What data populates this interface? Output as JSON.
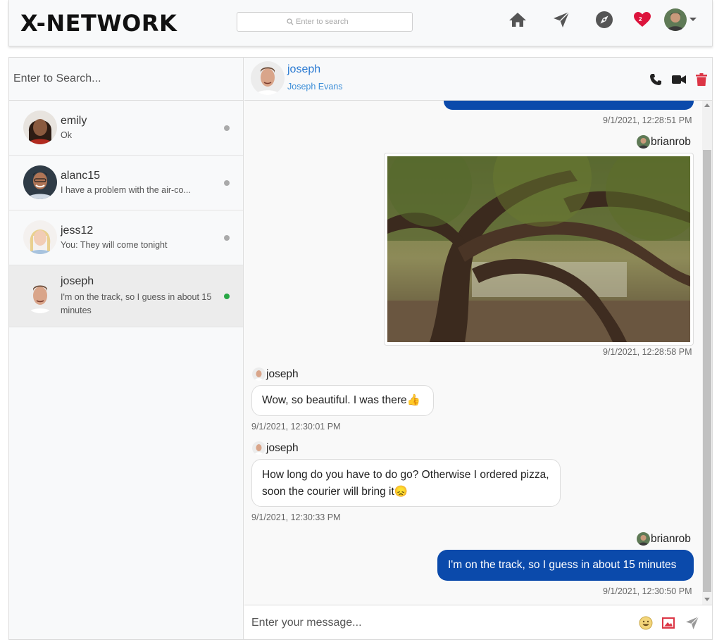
{
  "navbar": {
    "brand": "X-NETWORK",
    "search_placeholder": "Enter to search",
    "notification_count": "2",
    "icons": [
      "home-icon",
      "send-icon",
      "compass-icon",
      "heart-icon",
      "avatar",
      "chevron-down-icon"
    ]
  },
  "sidebar": {
    "search_placeholder": "Enter to Search...",
    "conversations": [
      {
        "name": "emily",
        "last": "Ok",
        "status": "offline"
      },
      {
        "name": "alanc15",
        "last": "I have a problem with the air-co...",
        "status": "offline"
      },
      {
        "name": "jess12",
        "last": "You: They will come tonight",
        "status": "offline"
      },
      {
        "name": "joseph",
        "last": "I'm on the track, so I guess in about 15 minutes",
        "status": "online",
        "active": true
      }
    ]
  },
  "chat": {
    "header": {
      "username": "joseph",
      "fullname": "Joseph Evans"
    },
    "messages": [
      {
        "from": "me",
        "sender": "brianrob",
        "type": "text",
        "text": "",
        "time": "9/1/2021, 12:28:51 PM"
      },
      {
        "from": "me",
        "sender": "brianrob",
        "type": "image",
        "time": "9/1/2021, 12:28:58 PM"
      },
      {
        "from": "them",
        "sender": "joseph",
        "type": "text",
        "text": "Wow, so beautiful. I was there👍",
        "time": "9/1/2021, 12:30:01 PM"
      },
      {
        "from": "them",
        "sender": "joseph",
        "type": "text",
        "text": "How long do you have to do go? Otherwise I ordered pizza, soon the courier will bring it😞",
        "time": "9/1/2021, 12:30:33 PM"
      },
      {
        "from": "me",
        "sender": "brianrob",
        "type": "text",
        "text": "I'm on the track, so I guess in about 15 minutes",
        "time": "9/1/2021, 12:30:50 PM"
      }
    ],
    "composer_placeholder": "Enter your message..."
  },
  "colors": {
    "accent": "#0b4aab",
    "link": "#2a7ad2",
    "danger": "#dc3545",
    "online": "#28a745",
    "offline": "#aaaaaa"
  }
}
